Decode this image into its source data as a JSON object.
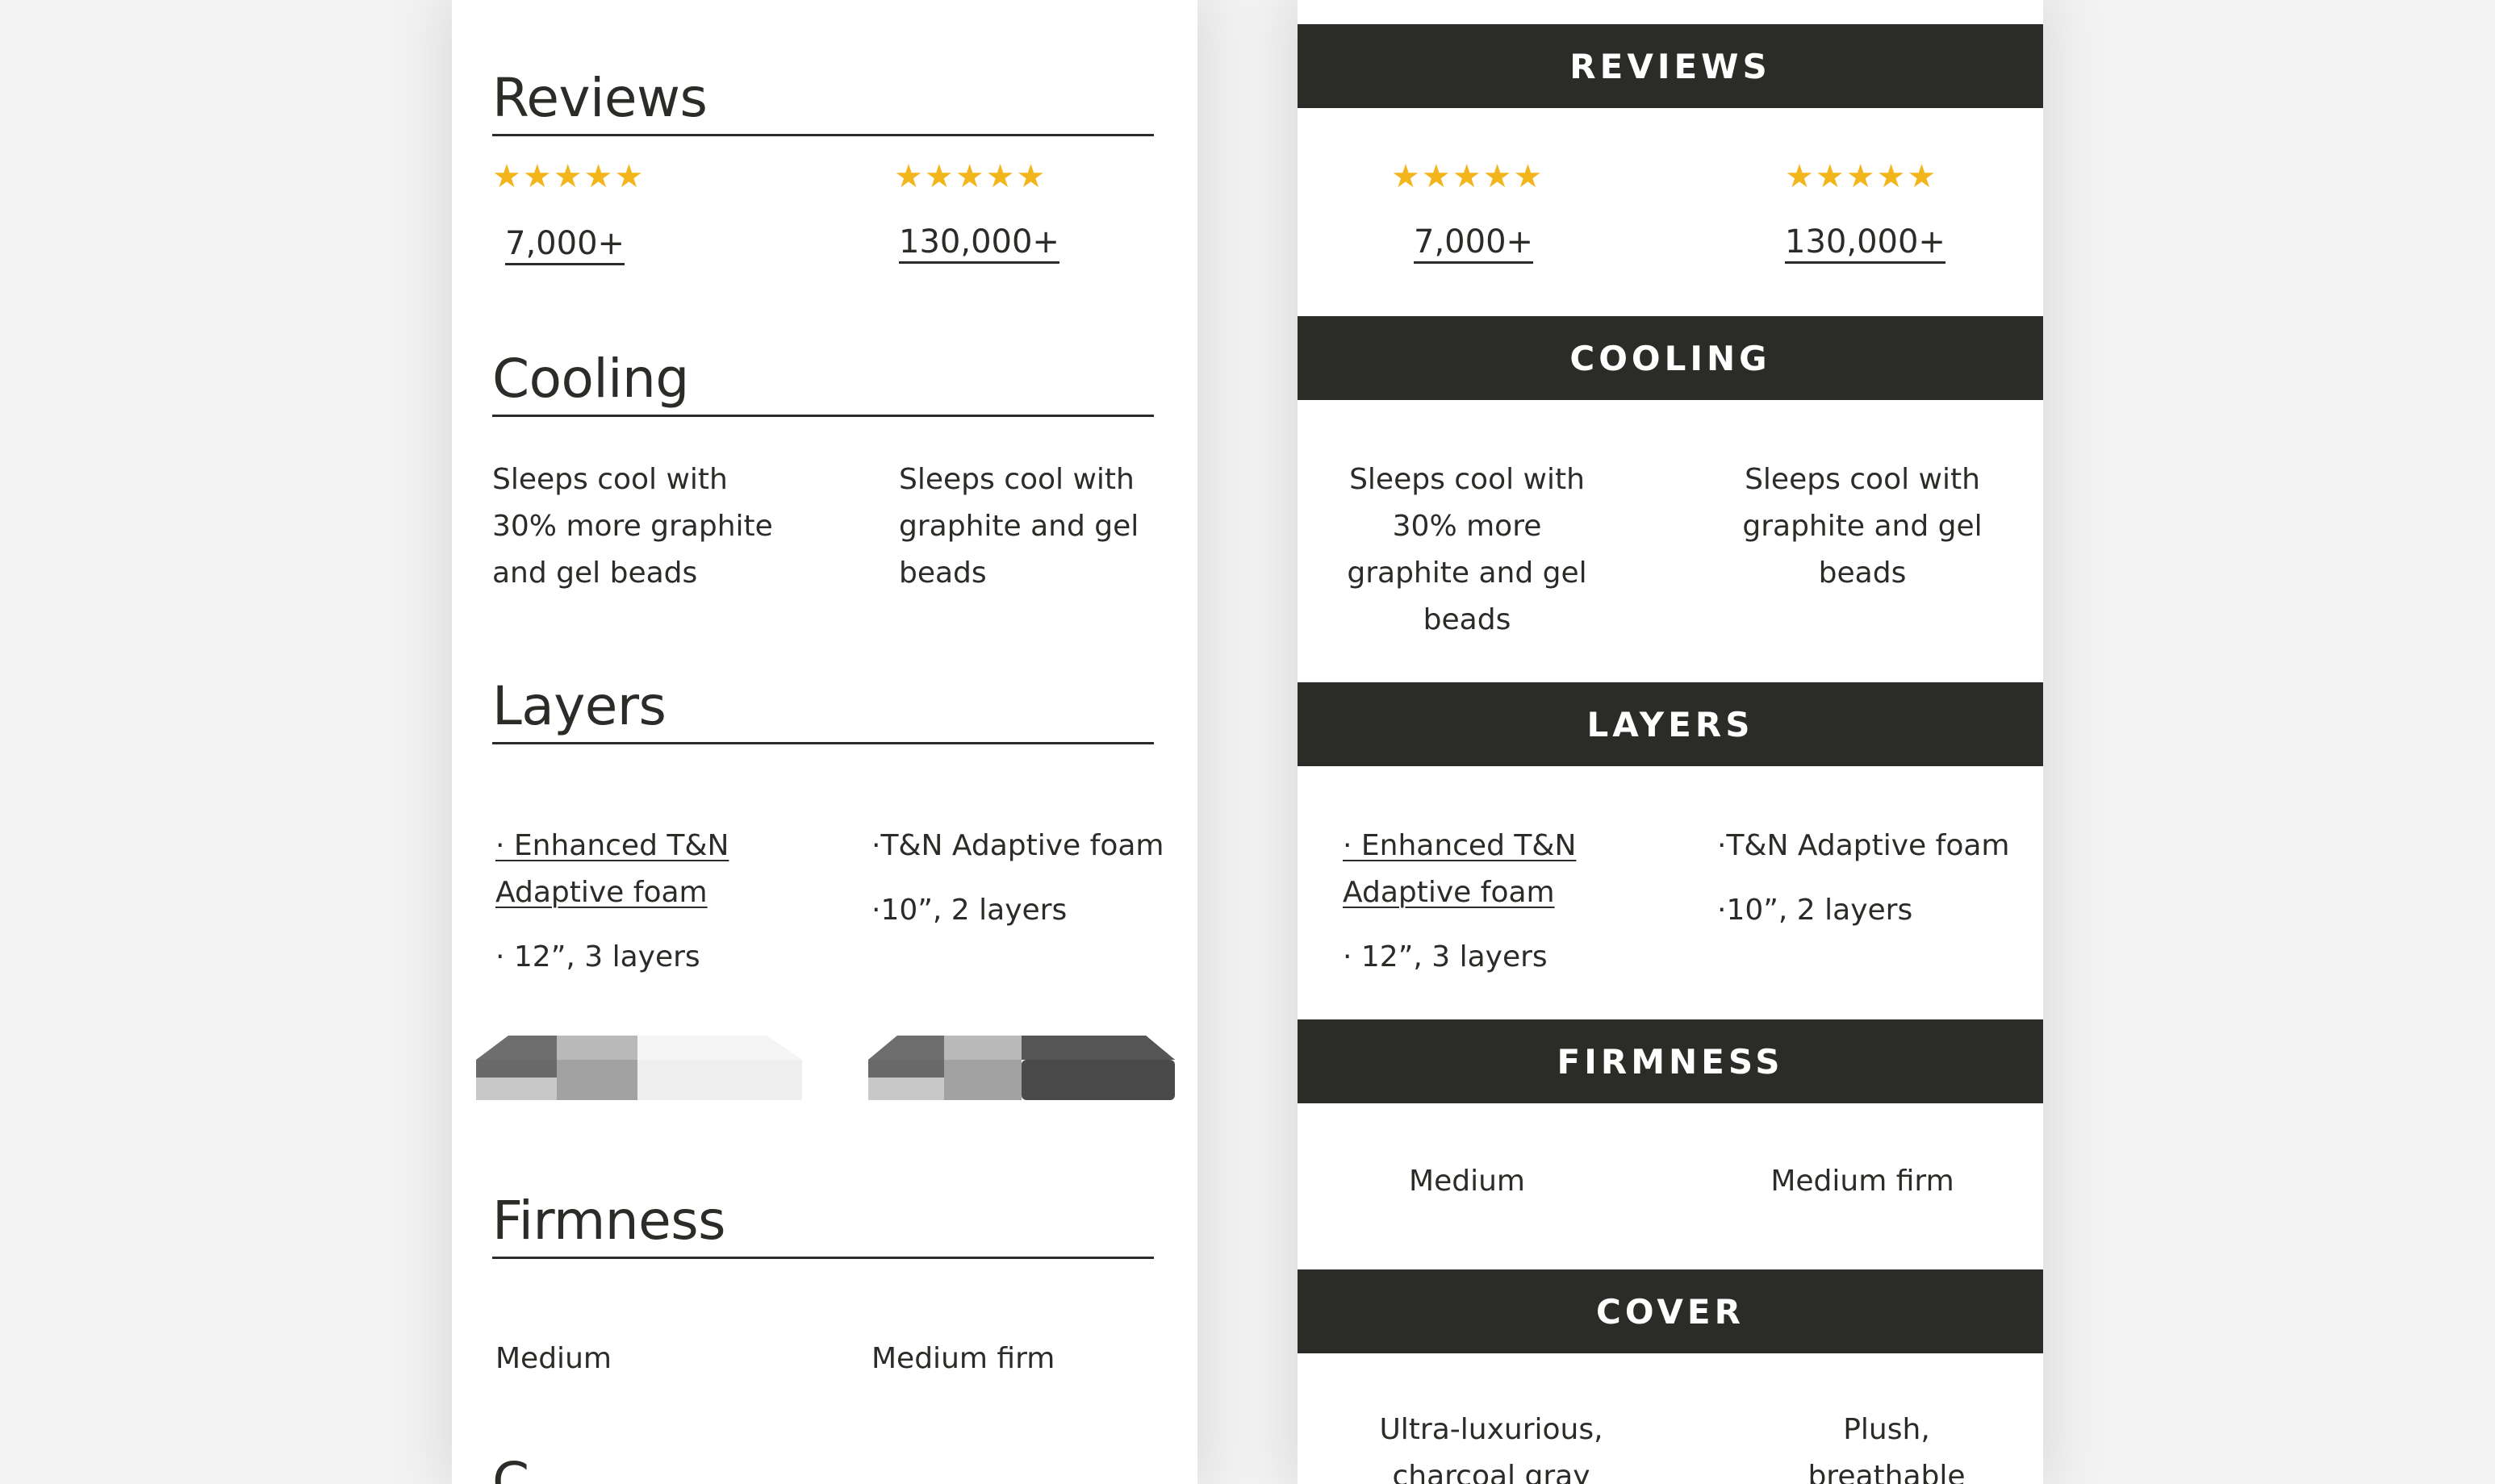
{
  "colors": {
    "dark": "#2b2b27",
    "star": "#f2b51c",
    "background": "#ffffff"
  },
  "stars": "★★★★★",
  "left": {
    "reviews": {
      "heading": "Reviews",
      "col1_count": "7,000+",
      "col2_count": "130,000+"
    },
    "cooling": {
      "heading": "Cooling",
      "col1": [
        "Sleeps cool with",
        "30% more graphite",
        "and gel beads"
      ],
      "col2": [
        "Sleeps cool with",
        "graphite and gel",
        "beads"
      ]
    },
    "layers": {
      "heading": "Layers",
      "col1_link": [
        "· Enhanced T&N",
        "Adaptive foam"
      ],
      "col1_detail": "· 12”, 3 layers",
      "col2_line1": "·T&N Adaptive foam",
      "col2_line2": "·10”, 2 layers"
    },
    "firmness": {
      "heading": "Firmness",
      "col1": "Medium",
      "col2": "Medium firm"
    },
    "next_heading_partial": "C"
  },
  "right": {
    "reviews": {
      "heading": "REVIEWS",
      "col1_count": "7,000+",
      "col2_count": "130,000+"
    },
    "cooling": {
      "heading": "COOLING",
      "col1": [
        "Sleeps cool with",
        "30% more",
        "graphite and gel",
        "beads"
      ],
      "col2": [
        "Sleeps cool with",
        "graphite and gel",
        "beads"
      ]
    },
    "layers": {
      "heading": "LAYERS",
      "col1_link": [
        "· Enhanced T&N",
        "Adaptive foam"
      ],
      "col1_detail": "· 12”, 3 layers",
      "col2_line1": "·T&N Adaptive foam",
      "col2_line2": "·10”, 2 layers"
    },
    "firmness": {
      "heading": "FIRMNESS",
      "col1": "Medium",
      "col2": "Medium firm"
    },
    "cover": {
      "heading": "COVER",
      "col1": [
        "Ultra-luxurious,",
        "charcoal gray"
      ],
      "col2": [
        "Plush,",
        "breathable"
      ]
    }
  }
}
